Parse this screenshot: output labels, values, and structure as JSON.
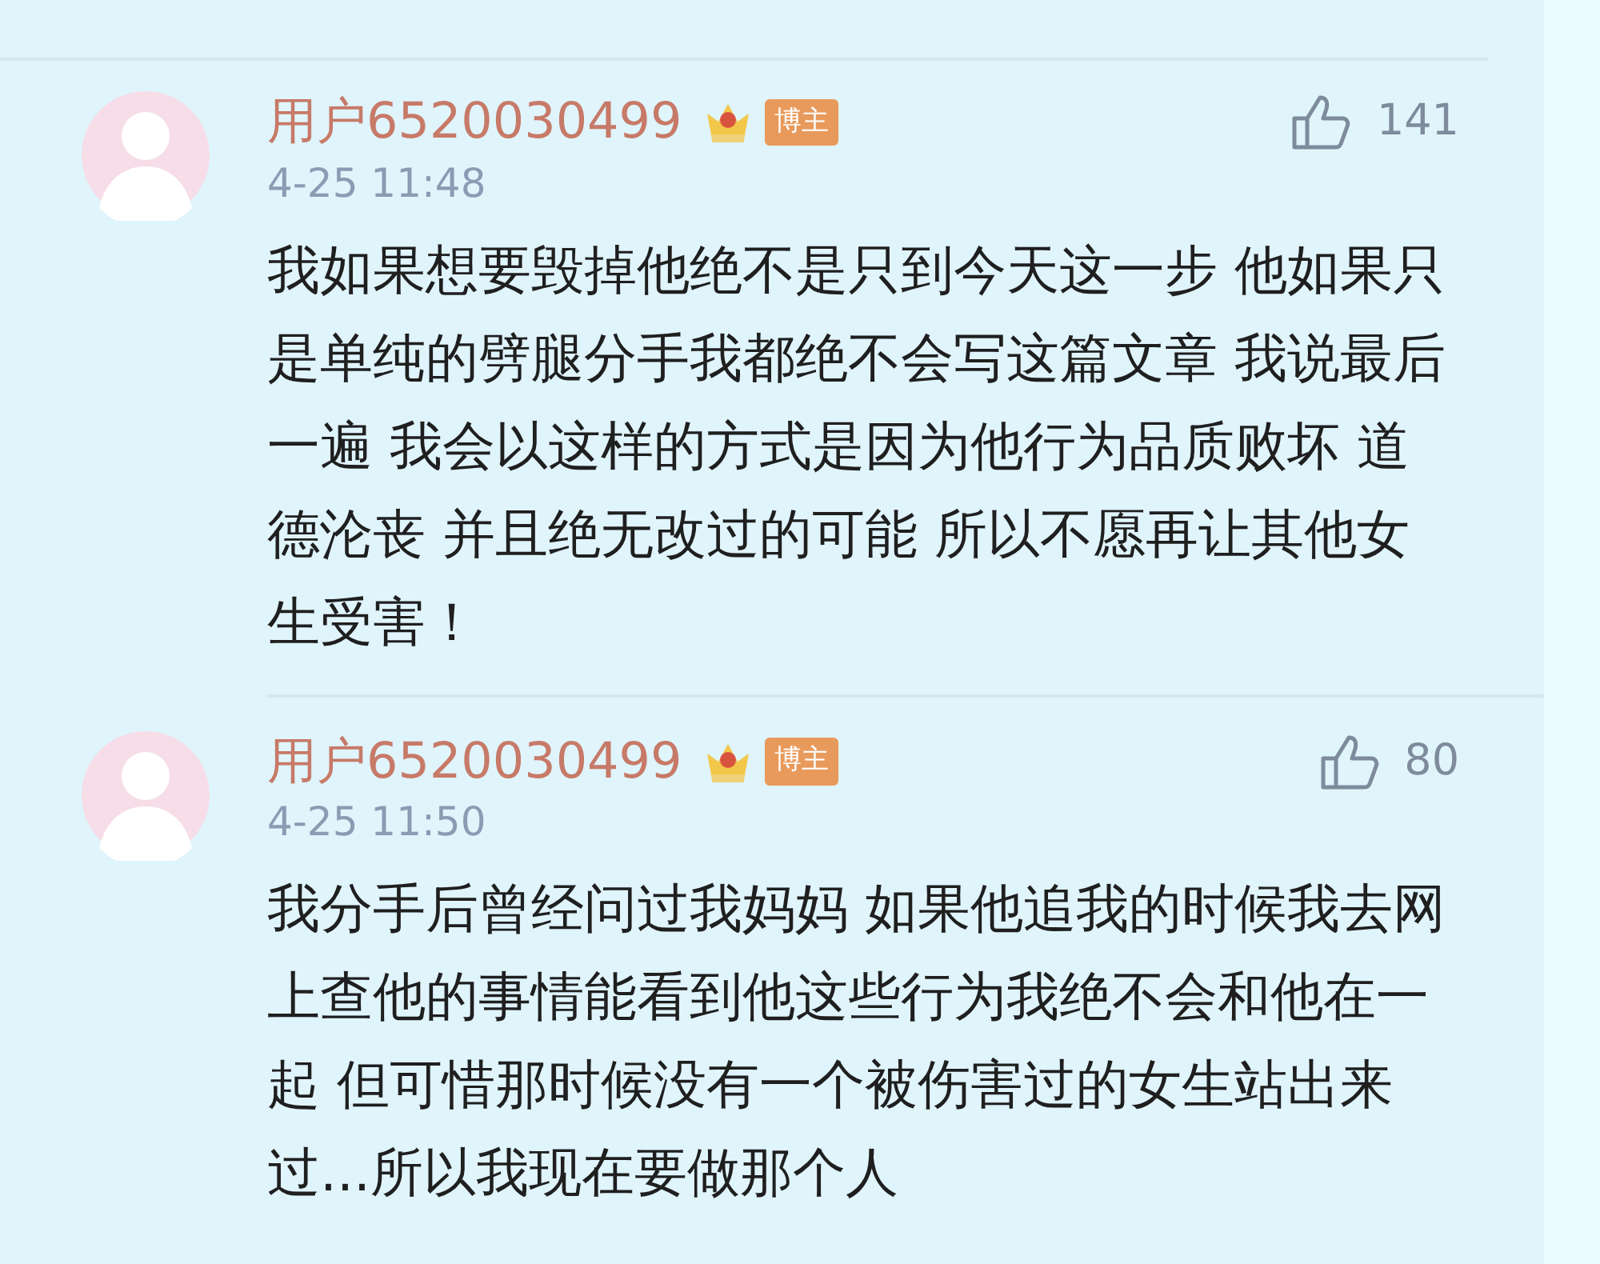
{
  "comments": [
    {
      "user": "用户6520030499",
      "badge": "博主",
      "time": "4-25 11:48",
      "likes": "141",
      "text": "我如果想要毁掉他绝不是只到今天这一步 他如果只是单纯的劈腿分手我都绝不会写这篇文章 我说最后一遍 我会以这样的方式是因为他行为品质败坏 道德沦丧 并且绝无改过的可能 所以不愿再让其他女生受害！"
    },
    {
      "user": "用户6520030499",
      "badge": "博主",
      "time": "4-25 11:50",
      "likes": "80",
      "text": "我分手后曾经问过我妈妈 如果他追我的时候我去网上查他的事情能看到他这些行为我绝不会和他在一起 但可惜那时候没有一个被伤害过的女生站出来过...所以我现在要做那个人"
    }
  ]
}
